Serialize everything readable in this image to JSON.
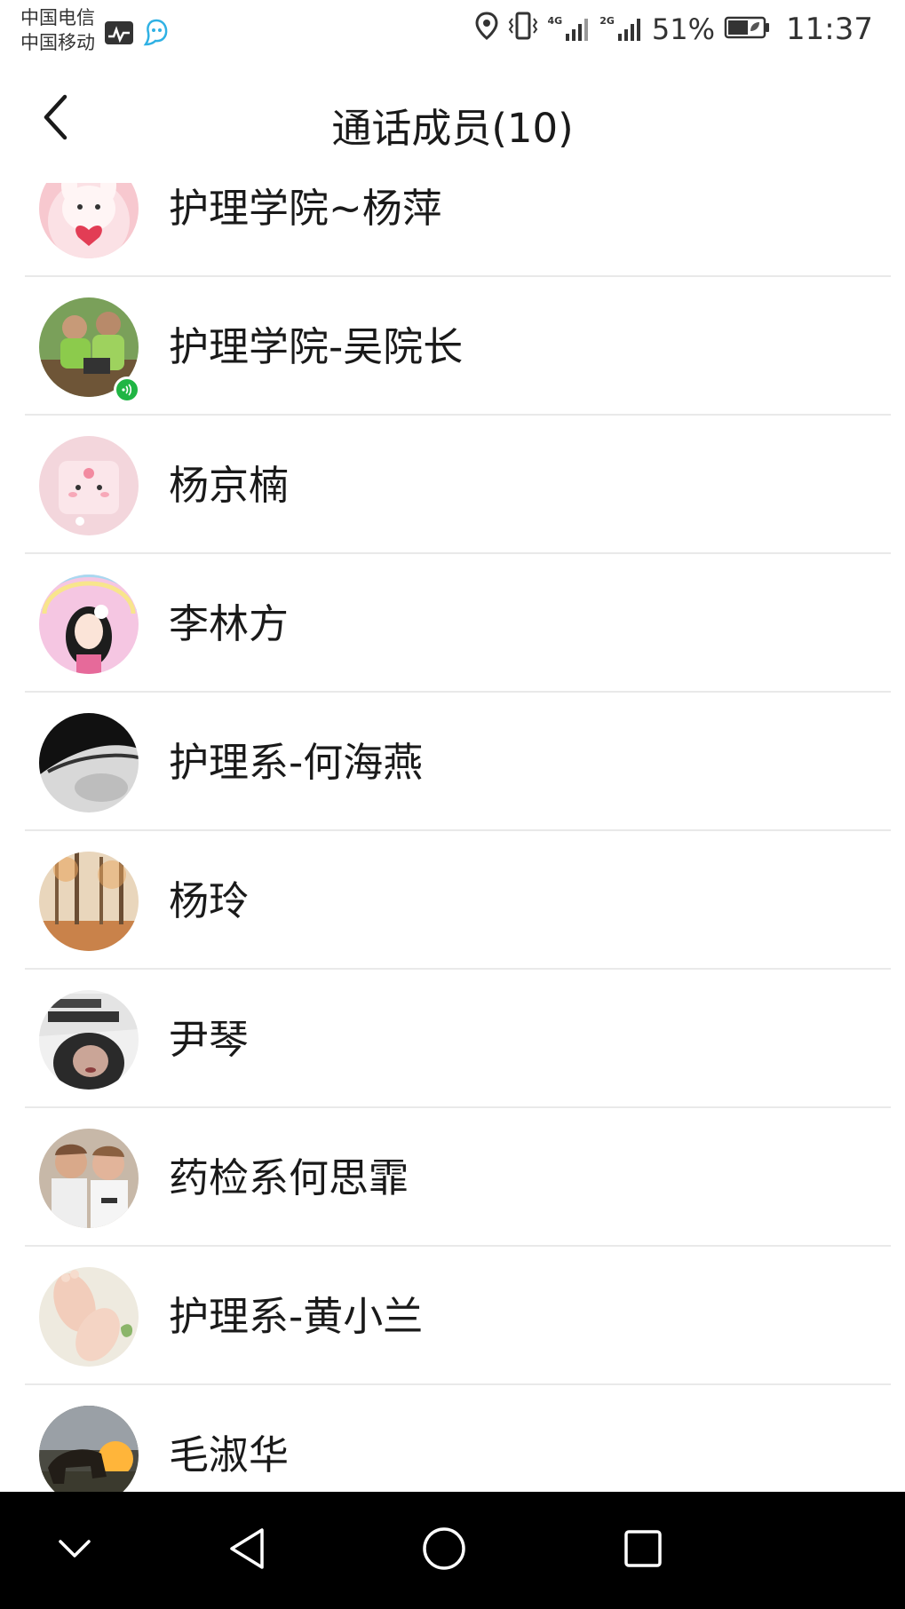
{
  "status_bar": {
    "carrier_1": "中国电信",
    "carrier_2": "中国移动",
    "network_1": "4G",
    "network_2": "2G",
    "battery_percent": "51%",
    "time": "11:37"
  },
  "header": {
    "title": "通话成员(10)",
    "back_icon": "chevron-left-icon"
  },
  "members": [
    {
      "name": "护理学院~杨萍",
      "avatar": "bunny-heart-avatar",
      "speaking": false
    },
    {
      "name": "护理学院-吴院长",
      "avatar": "couple-photo-avatar",
      "speaking": true
    },
    {
      "name": "杨京楠",
      "avatar": "pink-tofu-avatar",
      "speaking": false
    },
    {
      "name": "李林方",
      "avatar": "doll-girl-avatar",
      "speaking": false
    },
    {
      "name": "护理系-何海燕",
      "avatar": "eye-bw-avatar",
      "speaking": false
    },
    {
      "name": "杨玲",
      "avatar": "autumn-forest-avatar",
      "speaking": false
    },
    {
      "name": "尹琴",
      "avatar": "love-myself-avatar",
      "speaking": false
    },
    {
      "name": "药检系何思霏",
      "avatar": "two-people-avatar",
      "speaking": false
    },
    {
      "name": "护理系-黄小兰",
      "avatar": "baby-feet-avatar",
      "speaking": false
    },
    {
      "name": "毛淑华",
      "avatar": "sunset-horse-avatar",
      "speaking": false
    }
  ],
  "navigation_bar": {
    "buttons": [
      "chevron-down-icon",
      "back-triangle-icon",
      "home-circle-icon",
      "recents-square-icon"
    ]
  },
  "colors": {
    "speaking_badge": "#20b544",
    "divider": "#e9e9e9",
    "nav_background": "#000000"
  }
}
